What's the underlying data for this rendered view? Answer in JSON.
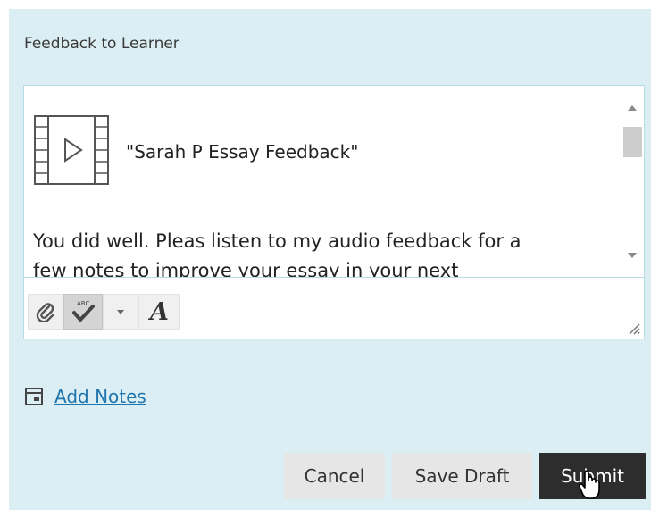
{
  "section": {
    "label": "Feedback to Learner"
  },
  "editor": {
    "video_title": "\"Sarah P Essay Feedback\"",
    "paragraph": "You did well.  Pleas listen to my audio feedback for a",
    "paragraph_next": "few notes to improve your essay in your next"
  },
  "toolbar": {
    "icons": [
      "paperclip-icon",
      "spellcheck-icon",
      "dropdown-arrow-icon",
      "font-style-icon",
      "resize-grip-icon"
    ],
    "font_label": "A"
  },
  "notes": {
    "link_label": "Add Notes",
    "icon": "notes-icon"
  },
  "actions": {
    "cancel_label": "Cancel",
    "save_draft_label": "Save Draft",
    "submit_label": "Submit"
  },
  "colors": {
    "panel_bg": "#dbeef4",
    "link": "#1f75ad",
    "submit_bg": "#2d2d2d",
    "secondary_bg": "#e6e6e6"
  }
}
